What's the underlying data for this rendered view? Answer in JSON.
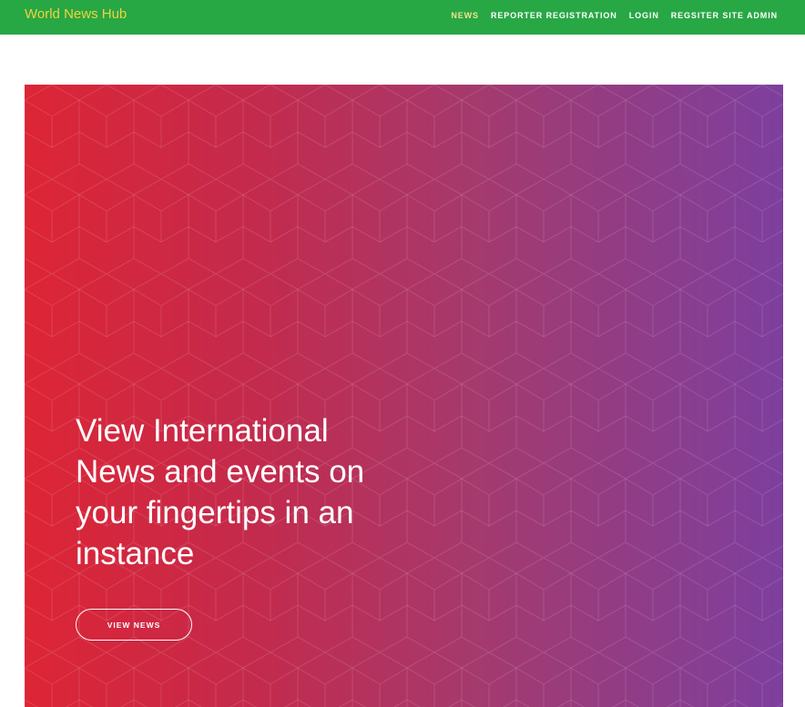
{
  "navbar": {
    "brand": "World News Hub",
    "links": [
      {
        "label": "NEWS",
        "active": true
      },
      {
        "label": "REPORTER REGISTRATION",
        "active": false
      },
      {
        "label": "LOGIN",
        "active": false
      },
      {
        "label": "REGSITER SITE ADMIN",
        "active": false
      }
    ]
  },
  "hero": {
    "title": "View International News and events on your fingertips in an instance",
    "button_label": "VIEW NEWS"
  },
  "colors": {
    "navbar_bg": "#28a745",
    "brand_text": "#f2d33a",
    "active_link": "#f5e28a",
    "hero_gradient_start": "#dd2535",
    "hero_gradient_end": "#7d3f9e"
  }
}
